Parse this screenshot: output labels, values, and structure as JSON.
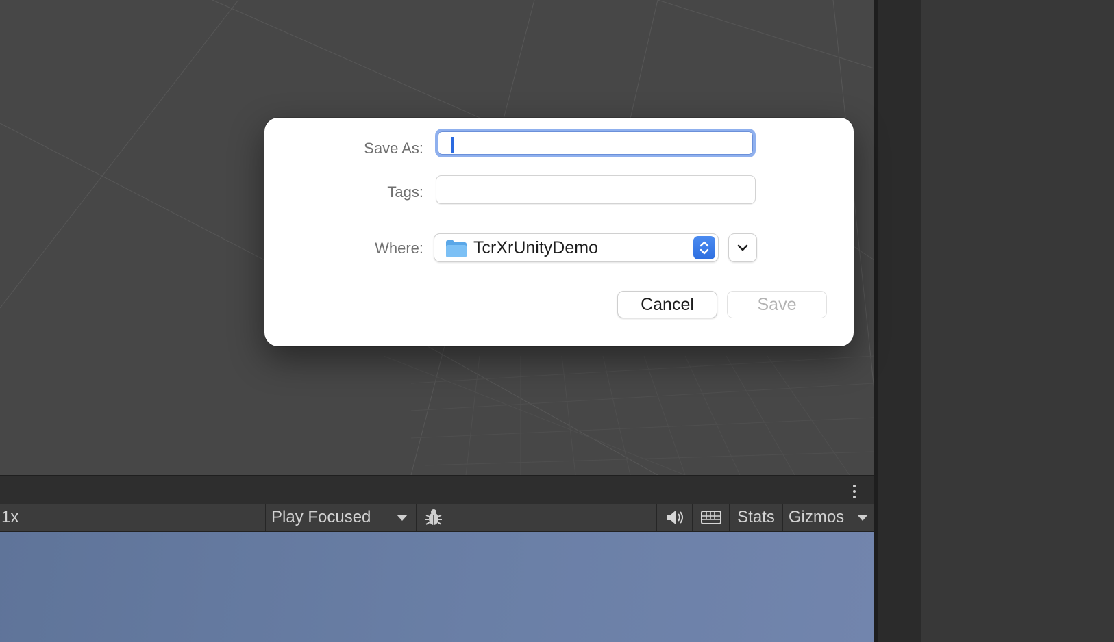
{
  "dialog": {
    "save_as_label": "Save As:",
    "save_as_value": "",
    "tags_label": "Tags:",
    "tags_value": "",
    "where_label": "Where:",
    "where_value": "TcrXrUnityDemo",
    "where_icon": "folder-icon",
    "cancel_label": "Cancel",
    "save_label": "Save"
  },
  "game_toolbar": {
    "scale_label": "1x",
    "play_mode": "Play Focused",
    "bug_icon": "bug-icon",
    "audio_icon": "speaker-icon",
    "keyboard_icon": "keyboard-icon",
    "stats_label": "Stats",
    "gizmos_label": "Gizmos"
  },
  "colors": {
    "scene_bg": "#474747",
    "accent": "#2e6fe0",
    "game_view": "#6a7fa6"
  }
}
